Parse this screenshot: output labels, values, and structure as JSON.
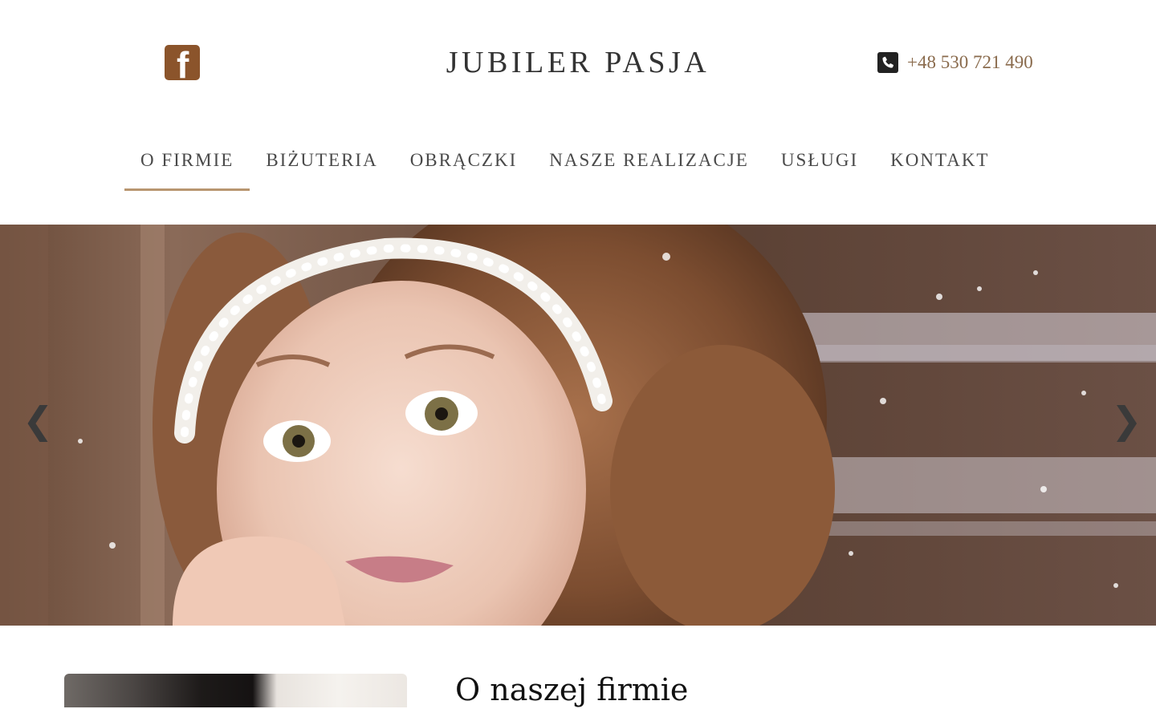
{
  "header": {
    "facebook_icon": "facebook-icon",
    "facebook_glyph": "f",
    "logo": "JUBILER PASJA",
    "phone_icon": "phone-icon",
    "phone": "+48 530 721 490"
  },
  "nav": {
    "items": [
      {
        "label": "O FIRMIE",
        "active": true
      },
      {
        "label": "BIŻUTERIA"
      },
      {
        "label": "OBRĄCZKI"
      },
      {
        "label": "NASZE REALIZACJE"
      },
      {
        "label": "USŁUGI"
      },
      {
        "label": "KONTAKT"
      }
    ]
  },
  "hero": {
    "prev_icon": "chevron-left-icon",
    "prev_glyph": "❮",
    "next_icon": "chevron-right-icon",
    "next_glyph": "❯"
  },
  "about": {
    "title": "O naszej firmie"
  },
  "colors": {
    "accent": "#b89670",
    "brand_brown": "#8b542b",
    "phone_text": "#8a6b4d",
    "nav_text": "#4a4a4a"
  }
}
